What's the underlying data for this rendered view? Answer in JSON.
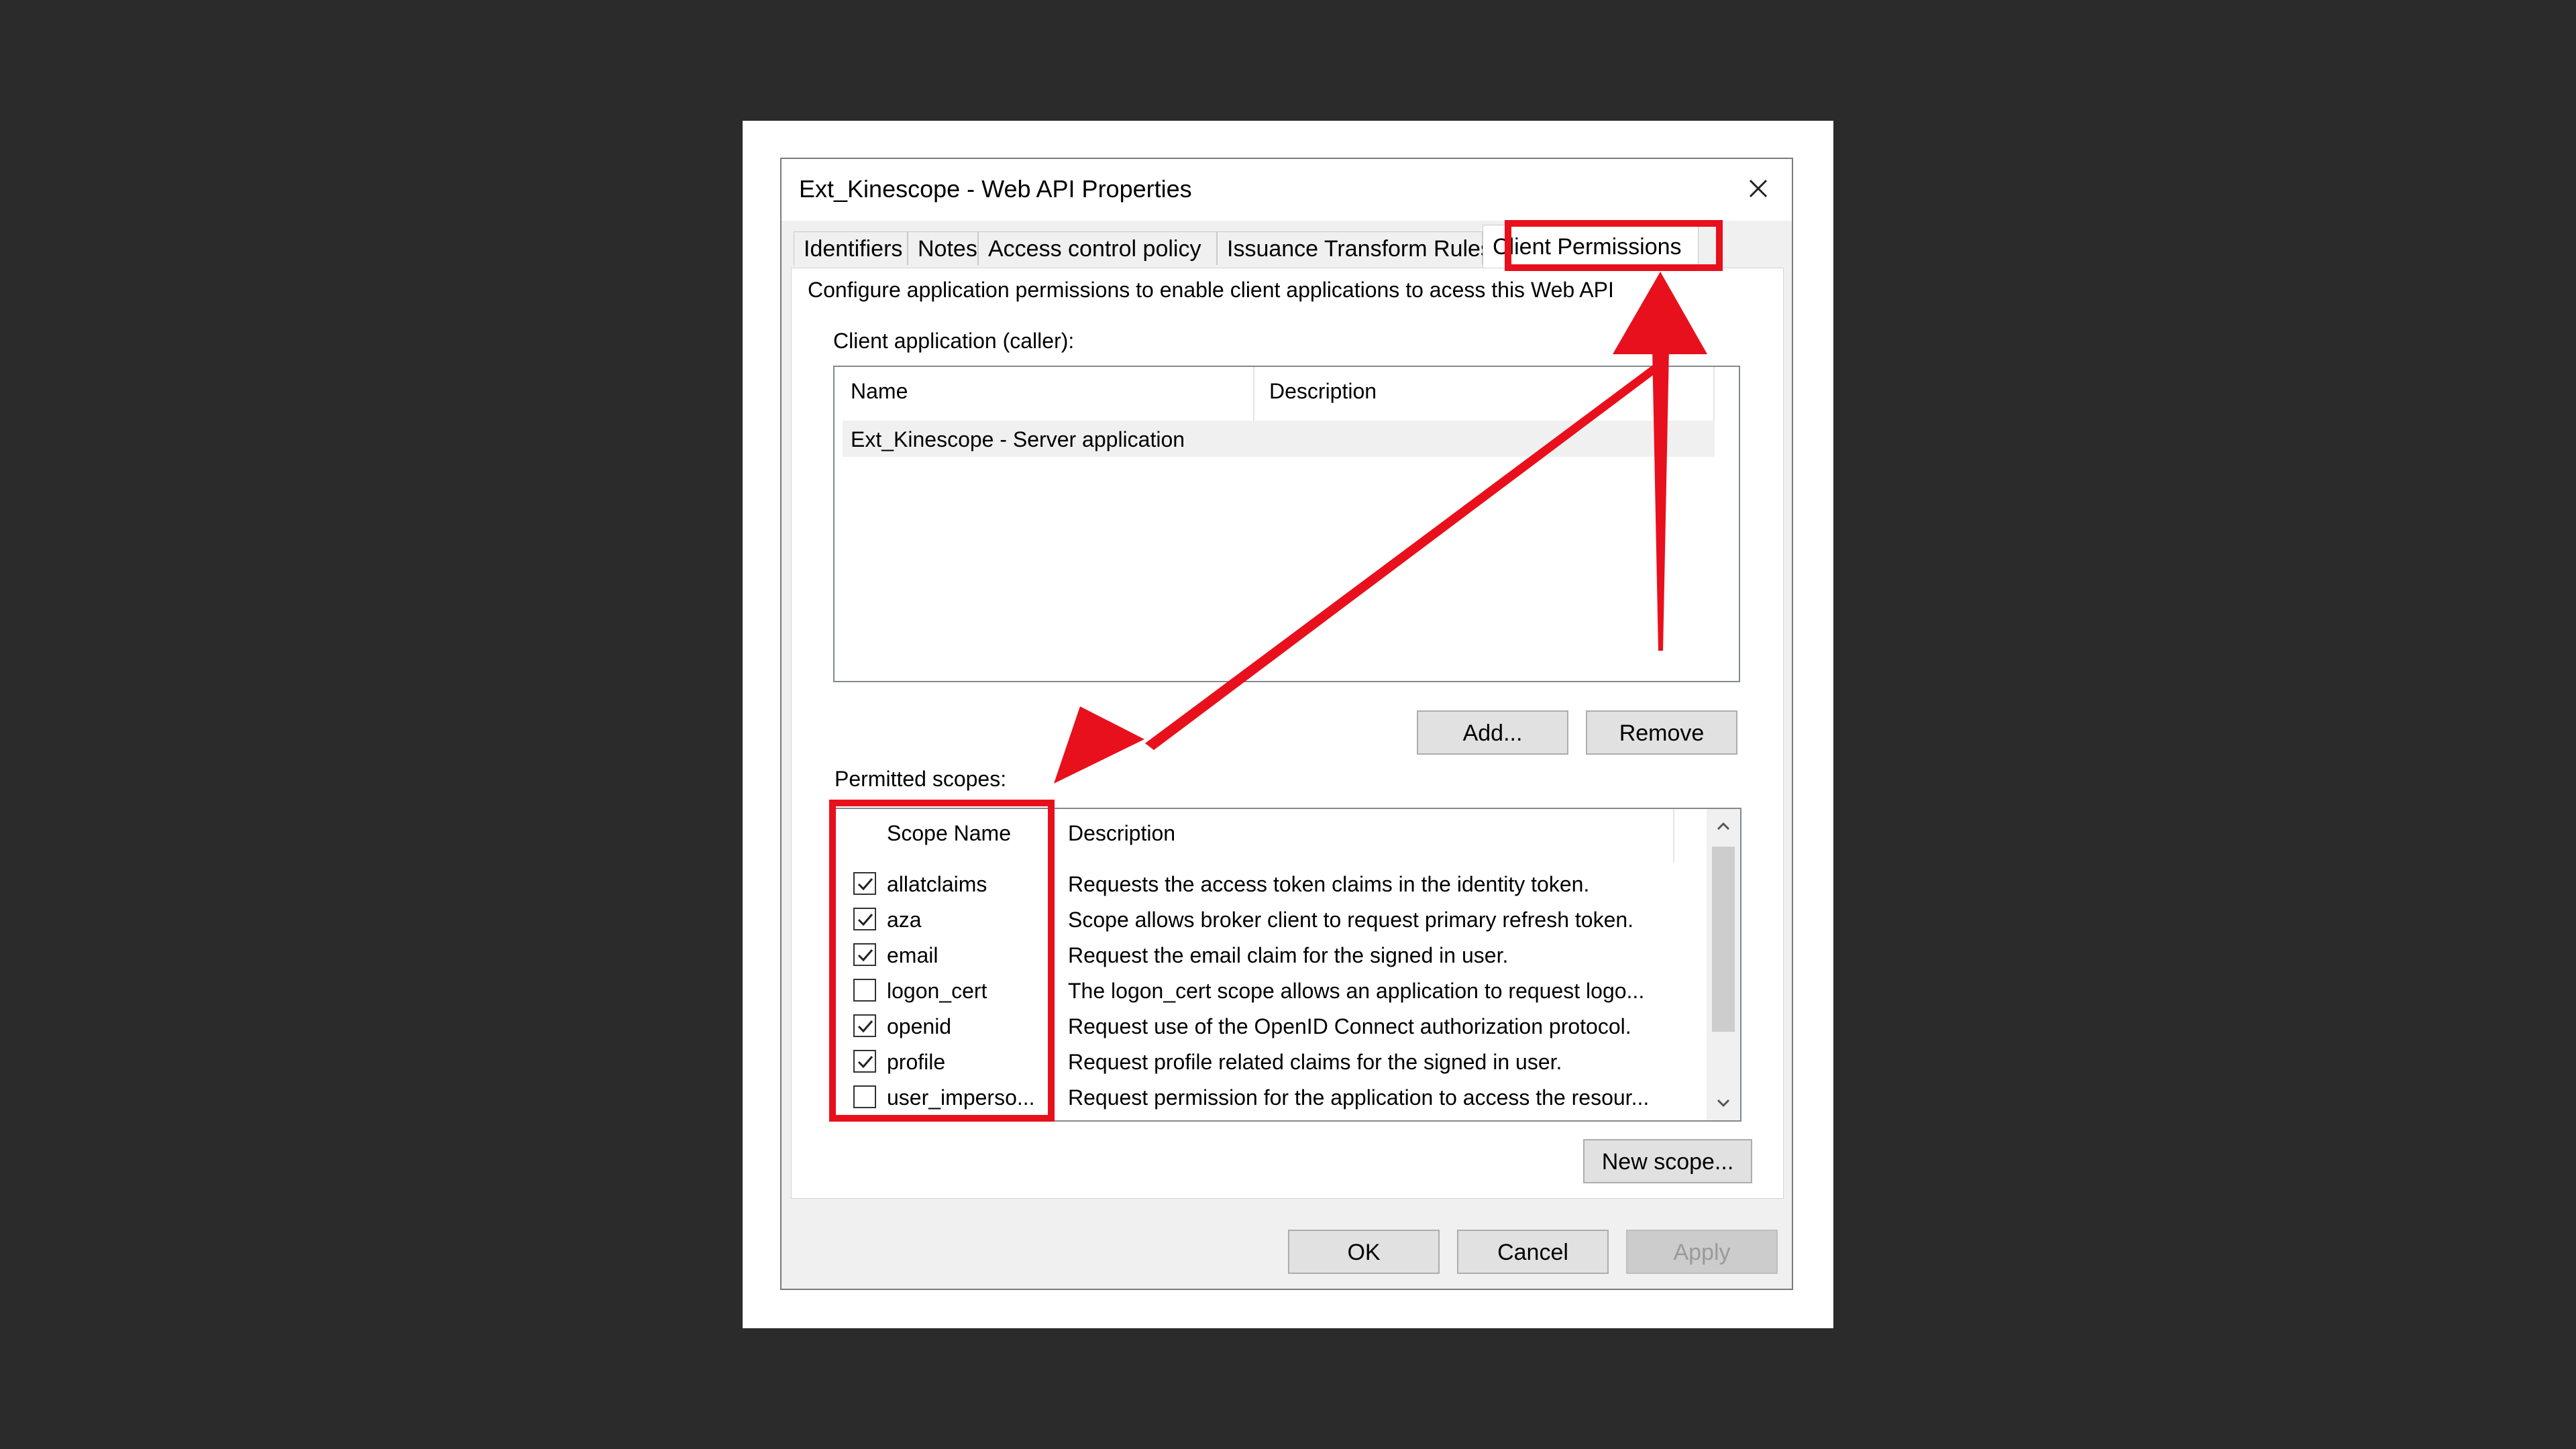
{
  "window": {
    "title": "Ext_Kinescope - Web API Properties"
  },
  "tabs": [
    {
      "label": "Identifiers"
    },
    {
      "label": "Notes"
    },
    {
      "label": "Access control policy"
    },
    {
      "label": "Issuance Transform Rules"
    },
    {
      "label": "Client Permissions",
      "active": true
    }
  ],
  "panel": {
    "intro": "Configure application permissions to enable client applications to acess this Web API",
    "client_label": "Client application (caller):",
    "clients_table": {
      "columns": [
        "Name",
        "Description"
      ],
      "rows": [
        {
          "name": "Ext_Kinescope - Server application",
          "description": ""
        }
      ]
    },
    "add_label": "Add...",
    "remove_label": "Remove",
    "scopes_label": "Permitted scopes:",
    "scopes_table": {
      "columns": [
        "Scope Name",
        "Description"
      ],
      "rows": [
        {
          "name": "allatclaims",
          "checked": true,
          "description": "Requests the access token claims in the identity token."
        },
        {
          "name": "aza",
          "checked": true,
          "description": "Scope allows broker client to request primary refresh token."
        },
        {
          "name": "email",
          "checked": true,
          "description": "Request the email claim for the signed in user."
        },
        {
          "name": "logon_cert",
          "checked": false,
          "description": "The logon_cert scope allows an application to request logo..."
        },
        {
          "name": "openid",
          "checked": true,
          "description": "Request use of the OpenID Connect authorization protocol."
        },
        {
          "name": "profile",
          "checked": true,
          "description": "Request profile related claims for the signed in user."
        },
        {
          "name": "user_imperso...",
          "checked": false,
          "description": "Request permission for the application to access the resour..."
        }
      ]
    },
    "new_scope_label": "New scope..."
  },
  "footer": {
    "ok_label": "OK",
    "cancel_label": "Cancel",
    "apply_label": "Apply"
  },
  "annotation": {
    "color": "#e8101c"
  }
}
